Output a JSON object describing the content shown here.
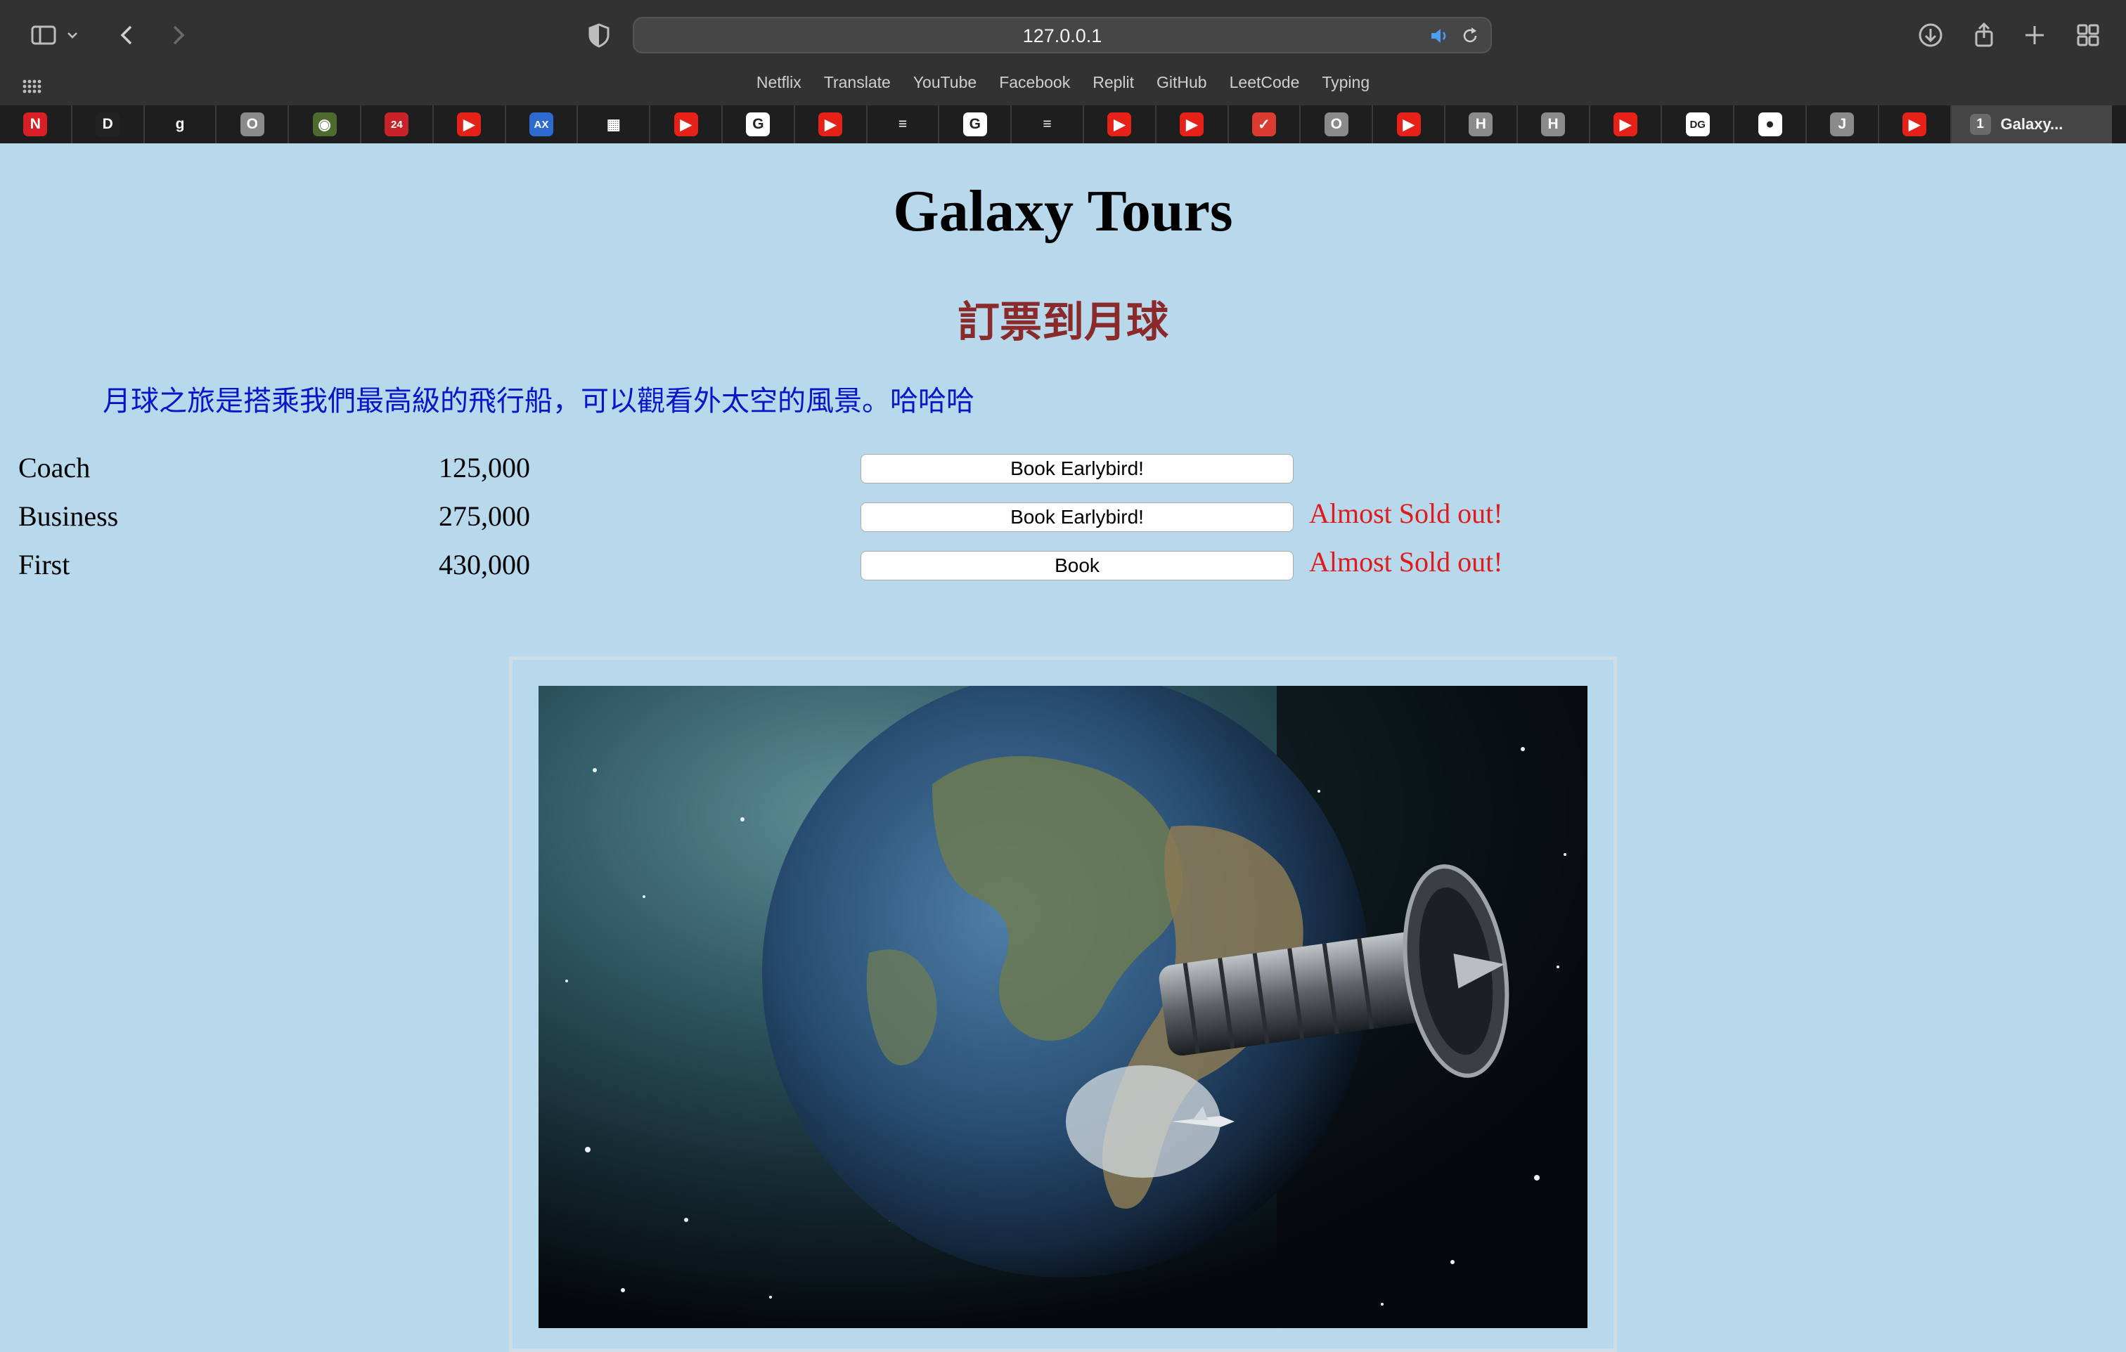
{
  "browser": {
    "url": "127.0.0.1",
    "bookmarks": [
      "Netflix",
      "Translate",
      "YouTube",
      "Facebook",
      "Replit",
      "GitHub",
      "LeetCode",
      "Typing"
    ],
    "tabs": [
      {
        "icon": "netflix-icon",
        "glyph": "N",
        "color": "#d81f26"
      },
      {
        "icon": "dashlane-icon",
        "glyph": "D",
        "color": "#222"
      },
      {
        "icon": "g-icon",
        "glyph": "g",
        "color": "#1e1e1e"
      },
      {
        "icon": "o-icon",
        "glyph": "O",
        "color": "#8a8a8a"
      },
      {
        "icon": "owl-icon",
        "glyph": "◉",
        "color": "#4d6b2f"
      },
      {
        "icon": "24-icon",
        "glyph": "24",
        "color": "#c8232a"
      },
      {
        "icon": "youtube-icon",
        "glyph": "▶",
        "color": "#e62117"
      },
      {
        "icon": "amex-icon",
        "glyph": "AX",
        "color": "#2d6bd1"
      },
      {
        "icon": "microsoft-icon",
        "glyph": "▦",
        "color": "#1e1e1e"
      },
      {
        "icon": "youtube-icon",
        "glyph": "▶",
        "color": "#e62117"
      },
      {
        "icon": "google-icon",
        "glyph": "G",
        "color": "#ffffff"
      },
      {
        "icon": "youtube-icon",
        "glyph": "▶",
        "color": "#e62117"
      },
      {
        "icon": "stackoverflow-icon",
        "glyph": "≡",
        "color": "#1e1e1e"
      },
      {
        "icon": "google-icon",
        "glyph": "G",
        "color": "#ffffff"
      },
      {
        "icon": "stackoverflow-icon",
        "glyph": "≡",
        "color": "#1e1e1e"
      },
      {
        "icon": "youtube-icon",
        "glyph": "▶",
        "color": "#e62117"
      },
      {
        "icon": "youtube-icon",
        "glyph": "▶",
        "color": "#e62117"
      },
      {
        "icon": "todoist-icon",
        "glyph": "✓",
        "color": "#db3b30"
      },
      {
        "icon": "o-icon",
        "glyph": "O",
        "color": "#8a8a8a"
      },
      {
        "icon": "youtube-icon",
        "glyph": "▶",
        "color": "#e62117"
      },
      {
        "icon": "h-icon",
        "glyph": "H",
        "color": "#8a8a8a"
      },
      {
        "icon": "h-icon",
        "glyph": "H",
        "color": "#8a8a8a"
      },
      {
        "icon": "youtube-icon",
        "glyph": "▶",
        "color": "#e62117"
      },
      {
        "icon": "dg-icon",
        "glyph": "DG",
        "color": "#ffffff"
      },
      {
        "icon": "github-icon",
        "glyph": "●",
        "color": "#ffffff"
      },
      {
        "icon": "j-icon",
        "glyph": "J",
        "color": "#8a8a8a"
      },
      {
        "icon": "youtube-icon",
        "glyph": "▶",
        "color": "#e62117"
      }
    ],
    "active_tab": {
      "badge": "1",
      "title": "Galaxy..."
    }
  },
  "page": {
    "title": "Galaxy Tours",
    "subtitle": "訂票到月球",
    "description": "月球之旅是搭乘我們最高級的飛行船，可以觀看外太空的風景。哈哈哈",
    "fares": [
      {
        "class": "Coach",
        "price": "125,000",
        "button": "Book Earlybird!",
        "note": ""
      },
      {
        "class": "Business",
        "price": "275,000",
        "button": "Book Earlybird!",
        "note": "Almost Sold out!"
      },
      {
        "class": "First",
        "price": "430,000",
        "button": "Book",
        "note": "Almost Sold out!"
      }
    ]
  },
  "colors": {
    "page_background": "#b8d8ec",
    "subtitle": "#8b2a2a",
    "description": "#0a14c8",
    "sold_out": "#e01b1b"
  }
}
